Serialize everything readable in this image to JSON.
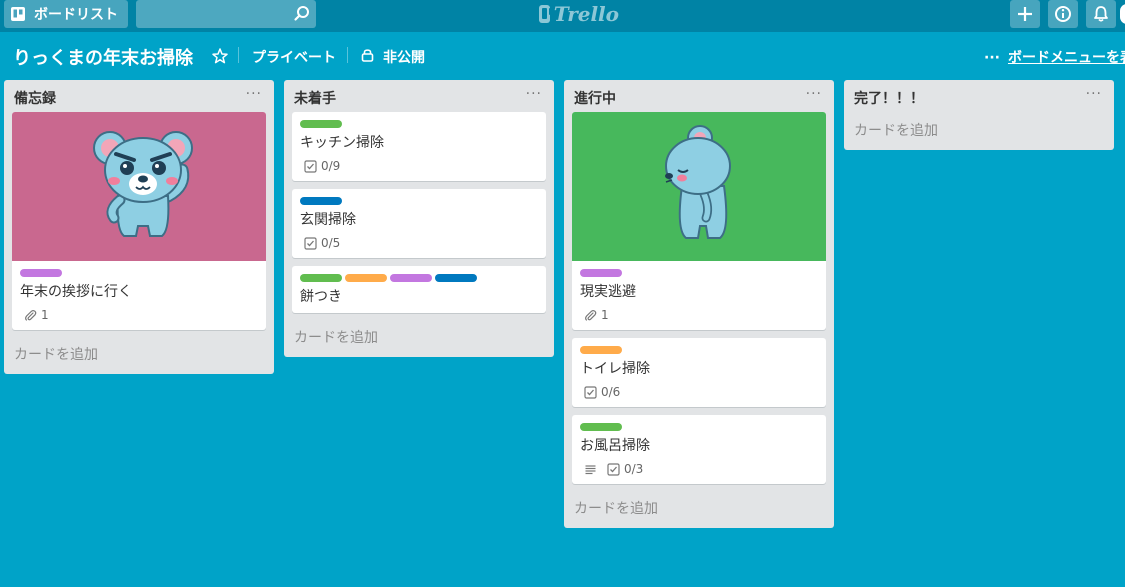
{
  "colors": {
    "background": "#00a3c8",
    "header": "#0083a5",
    "list_bg": "#e2e4e6",
    "label_green": "#61bd4f",
    "label_orange": "#ffab4a",
    "label_purple": "#c377e0",
    "label_blue": "#0079bf",
    "cover_pink": "#c9688f",
    "cover_green": "#47b85c"
  },
  "header": {
    "boards_label": "ボードリスト",
    "logo_text": "Trello",
    "icons": [
      "board-icon",
      "search-icon",
      "plus-icon",
      "info-icon",
      "bell-icon"
    ]
  },
  "board": {
    "title": "りっくまの年末お掃除",
    "privacy": "プライベート",
    "visibility": "非公開",
    "menu_dots": "···",
    "menu_label": "ボードメニューを表示"
  },
  "lists": [
    {
      "title": "備忘録",
      "menu": "···",
      "add_card": "カードを追加",
      "cards": [
        {
          "cover": "pink",
          "labels": [
            "purple"
          ],
          "title": "年末の挨拶に行く",
          "attachments": "1"
        }
      ]
    },
    {
      "title": "未着手",
      "menu": "···",
      "add_card": "カードを追加",
      "cards": [
        {
          "labels": [
            "green"
          ],
          "title": "キッチン掃除",
          "checklist": "0/9"
        },
        {
          "labels": [
            "blue"
          ],
          "title": "玄関掃除",
          "checklist": "0/5"
        },
        {
          "labels": [
            "green",
            "orange",
            "purple",
            "blue"
          ],
          "title": "餅つき"
        }
      ]
    },
    {
      "title": "進行中",
      "menu": "···",
      "add_card": "カードを追加",
      "cards": [
        {
          "cover": "green",
          "labels": [
            "purple"
          ],
          "title": "現実逃避",
          "attachments": "1"
        },
        {
          "labels": [
            "orange"
          ],
          "title": "トイレ掃除",
          "checklist": "0/6"
        },
        {
          "labels": [
            "green"
          ],
          "title": "お風呂掃除",
          "has_description": true,
          "checklist": "0/3"
        }
      ]
    },
    {
      "title": "完了！！！",
      "menu": "···",
      "add_card": "カードを追加",
      "cards": []
    }
  ]
}
